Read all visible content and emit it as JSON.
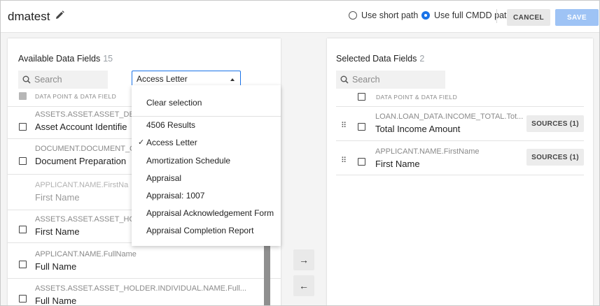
{
  "header": {
    "title": "dmatest",
    "short_path_label": "Use short path",
    "full_path_label": "Use full CMDD path",
    "path_mode_selected": "full",
    "cancel_label": "CANCEL",
    "save_label": "SAVE"
  },
  "available": {
    "title": "Available Data Fields",
    "count": "15",
    "search_placeholder": "Search",
    "filter_value": "Access Letter",
    "column_header": "DATA POINT & DATA FIELD",
    "rows": [
      {
        "path": "ASSETS.ASSET.ASSET_DE",
        "name": "Asset Account Identifie"
      },
      {
        "path": "DOCUMENT.DOCUMENT_C",
        "name": "Document Preparation"
      },
      {
        "path": "APPLICANT.NAME.FirstNa",
        "name": "First Name"
      },
      {
        "path": "ASSETS.ASSET.ASSET_HO",
        "name": "First Name"
      },
      {
        "path": "APPLICANT.NAME.FullName",
        "name": "Full Name"
      },
      {
        "path": "ASSETS.ASSET.ASSET_HOLDER.INDIVIDUAL.NAME.Full...",
        "name": "Full Name"
      }
    ]
  },
  "dropdown": {
    "clear_label": "Clear selection",
    "options": [
      {
        "label": "4506 Results",
        "selected": false
      },
      {
        "label": "Access Letter",
        "selected": true
      },
      {
        "label": "Amortization Schedule",
        "selected": false
      },
      {
        "label": "Appraisal",
        "selected": false
      },
      {
        "label": "Appraisal: 1007",
        "selected": false
      },
      {
        "label": "Appraisal Acknowledgement Form",
        "selected": false
      },
      {
        "label": "Appraisal Completion Report",
        "selected": false
      }
    ]
  },
  "transfer": {
    "add_symbol": "→",
    "remove_symbol": "←"
  },
  "selected": {
    "title": "Selected Data Fields",
    "count": "2",
    "search_placeholder": "Search",
    "column_header": "DATA POINT & DATA FIELD",
    "rows": [
      {
        "path": "LOAN.LOAN_DATA.INCOME_TOTAL.Tot...",
        "name": "Total Income Amount",
        "sources_label": "SOURCES (1)"
      },
      {
        "path": "APPLICANT.NAME.FirstName",
        "name": "First Name",
        "sources_label": "SOURCES (1)"
      }
    ]
  },
  "colors": {
    "accent": "#1a73e8",
    "save_disabled": "#9ec3f5"
  }
}
